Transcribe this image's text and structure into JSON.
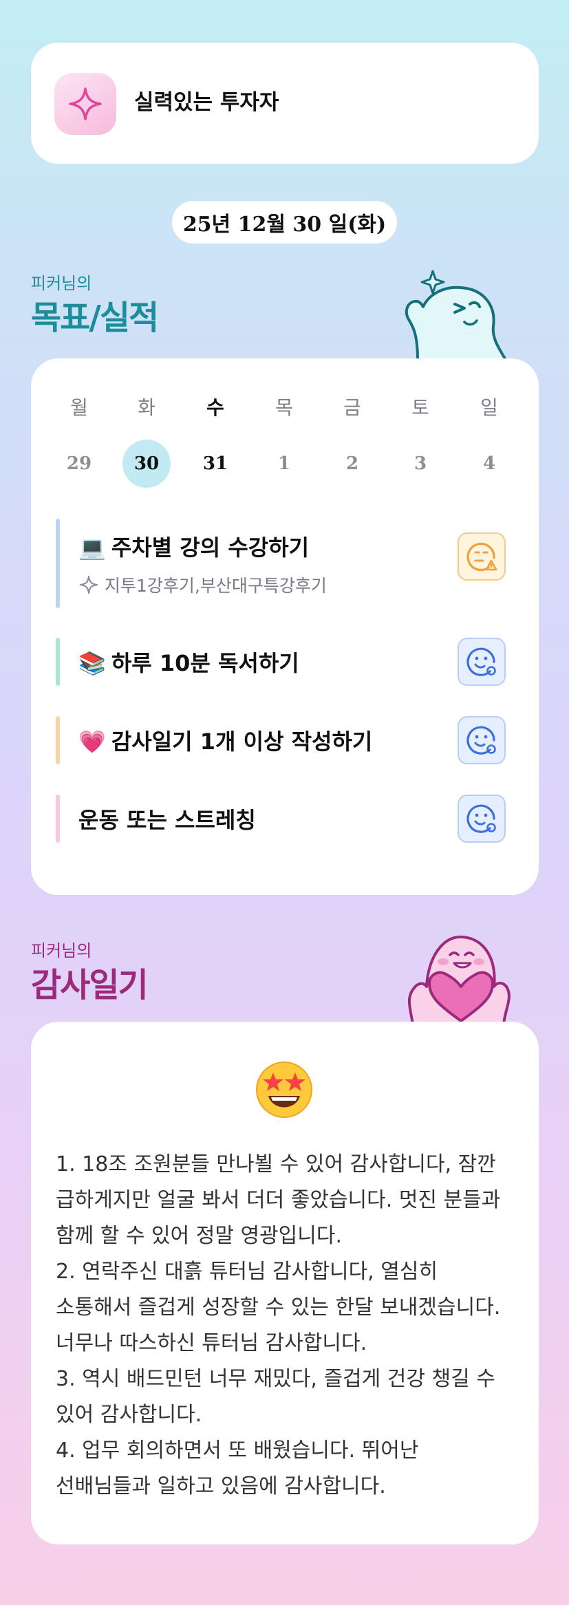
{
  "profile": {
    "name": "실력있는 투자자",
    "icon": "sparkle-icon"
  },
  "date": "25년 12월 30 일(화)",
  "goals_section": {
    "subtitle": "피커님의",
    "title": "목표/실적"
  },
  "week": {
    "days": [
      "월",
      "화",
      "수",
      "목",
      "금",
      "토",
      "일"
    ],
    "dates": [
      "29",
      "30",
      "31",
      "1",
      "2",
      "3",
      "4"
    ],
    "selected_index": 1
  },
  "goals": [
    {
      "emoji": "💻",
      "label": "주차별 강의 수강하기",
      "sub": "지투1강후기,부산대구특강후기",
      "bar_color": "#bcd3f6",
      "status": "warning",
      "status_icon": "face-warning-icon"
    },
    {
      "emoji": "📚",
      "label": "하루 10분 독서하기",
      "bar_color": "#a8e8cf",
      "status": "done",
      "status_icon": "face-smile-icon"
    },
    {
      "emoji": "💗",
      "label": "감사일기 1개 이상 작성하기",
      "bar_color": "#fbd3a3",
      "status": "done",
      "status_icon": "face-smile-icon"
    },
    {
      "emoji": "",
      "label": "운동 또는 스트레칭",
      "bar_color": "#f7c8e3",
      "status": "done",
      "status_icon": "face-smile-icon"
    }
  ],
  "diary_section": {
    "subtitle": "피커님의",
    "title": "감사일기"
  },
  "diary": {
    "emoji": "star-struck-face",
    "text": "1. 18조 조원분들 만나뵐 수 있어 감사합니다, 잠깐 급하게지만 얼굴 봐서 더더 좋았습니다. 멋진 분들과 함께 할 수 있어 정말 영광입니다.\n2. 연락주신 대흙 튜터님 감사합니다, 열심히 소통해서 즐겁게 성장할 수 있는 한달 보내겠습니다. 너무나 따스하신 튜터님 감사합니다.\n3. 역시 배드민턴 너무 재밌다, 즐겁게 건강 챙길 수 있어 감사합니다.\n4. 업무 회의하면서 또 배웠습니다. 뛰어난 선배님들과 일하고 있음에 감사합니다."
  },
  "colors": {
    "teal_title": "#1c8e9a",
    "magenta_title": "#9b2a7d",
    "selected_day": "#c2eaf3"
  }
}
